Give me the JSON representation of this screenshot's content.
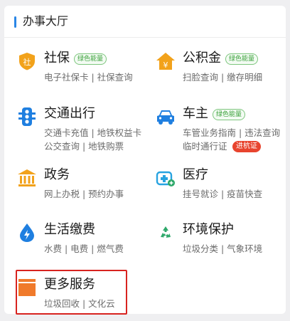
{
  "header": {
    "title": "办事大厅"
  },
  "services": {
    "social": {
      "name": "社保",
      "badge": "绿色能量",
      "line1": "电子社保卡 | 社保查询",
      "icon": "shield-icon",
      "color": "#f2a21b"
    },
    "fund": {
      "name": "公积金",
      "badge": "绿色能量",
      "line1": "扫脸查询 | 缴存明细",
      "icon": "house-yen-icon",
      "color": "#f2a21b"
    },
    "transport": {
      "name": "交通出行",
      "line1": "交通卡充值 | 地铁权益卡",
      "line2": "公交查询 | 地铁购票",
      "icon": "traffic-light-icon",
      "color": "#1f7fe0"
    },
    "car": {
      "name": "车主",
      "badge": "绿色能量",
      "line1": "车管业务指南 | 违法查询",
      "line2": "临时通行证",
      "red_badge": "进杭证",
      "icon": "car-icon",
      "color": "#1f7fe0"
    },
    "gov": {
      "name": "政务",
      "line1": "网上办税 | 预约办事",
      "icon": "government-building-icon",
      "color": "#f2a21b"
    },
    "medical": {
      "name": "医疗",
      "line1": "挂号就诊 | 疫苗快查",
      "icon": "medical-cross-icon",
      "color": "#27a3e0"
    },
    "utility": {
      "name": "生活缴费",
      "line1": "水费 | 电费 | 燃气费",
      "icon": "water-drop-icon",
      "color": "#1f7fe0"
    },
    "env": {
      "name": "环境保护",
      "line1": "垃圾分类 | 气象环境",
      "icon": "recycle-icon",
      "color": "#2ea86a"
    },
    "more": {
      "name": "更多服务",
      "line1": "垃圾回收 | 文化云",
      "icon": "box-icon",
      "color": "#f07a2b"
    }
  },
  "highlight_color": "#d8231f"
}
